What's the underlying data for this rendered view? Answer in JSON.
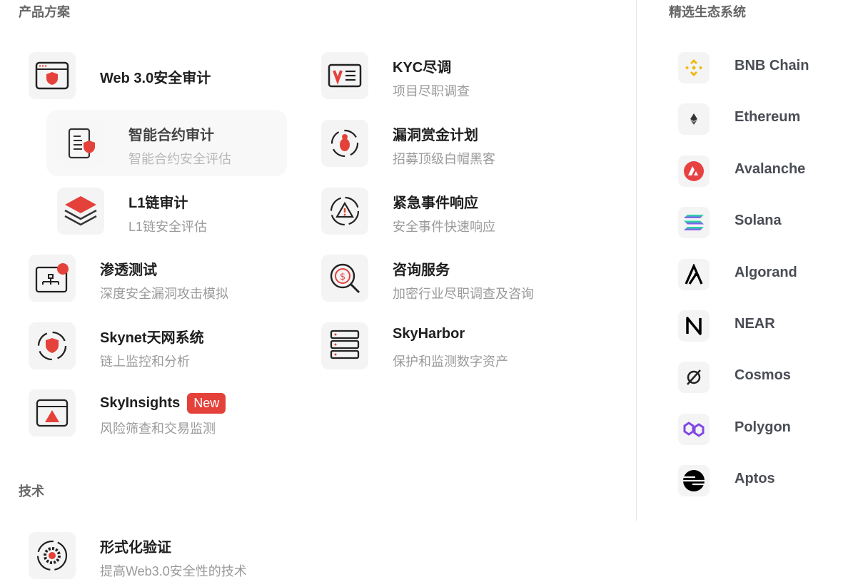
{
  "sections": {
    "products": "产品方案",
    "tech": "技术",
    "ecosystems": "精选生态系统"
  },
  "products": [
    {
      "title": "Web 3.0安全审计"
    },
    {
      "title": "智能合约审计",
      "subtitle": "智能合约安全评估"
    },
    {
      "title": "L1链审计",
      "subtitle": "L1链安全评估"
    },
    {
      "title": "渗透测试",
      "subtitle": "深度安全漏洞攻击模拟"
    },
    {
      "title": "Skynet天网系统",
      "subtitle": "链上监控和分析"
    },
    {
      "title": "SkyInsights",
      "badge": "New",
      "subtitle": "风险筛查和交易监测"
    },
    {
      "title": "KYC尽调",
      "subtitle": "项目尽职调查"
    },
    {
      "title": "漏洞赏金计划",
      "subtitle": "招募顶级白帽黑客"
    },
    {
      "title": "紧急事件响应",
      "subtitle": "安全事件快速响应"
    },
    {
      "title": "咨询服务",
      "subtitle": "加密行业尽职调查及咨询"
    },
    {
      "title": "SkyHarbor",
      "subtitle": "保护和监测数字资产"
    }
  ],
  "tech": [
    {
      "title": "形式化验证",
      "subtitle": "提高Web3.0安全性的技术"
    }
  ],
  "ecosystems": [
    "BNB Chain",
    "Ethereum",
    "Avalanche",
    "Solana",
    "Algorand",
    "NEAR",
    "Cosmos",
    "Polygon",
    "Aptos"
  ],
  "colors": {
    "accent": "#e5413b",
    "bnb": "#f0b90b",
    "polygon": "#8247e5"
  }
}
